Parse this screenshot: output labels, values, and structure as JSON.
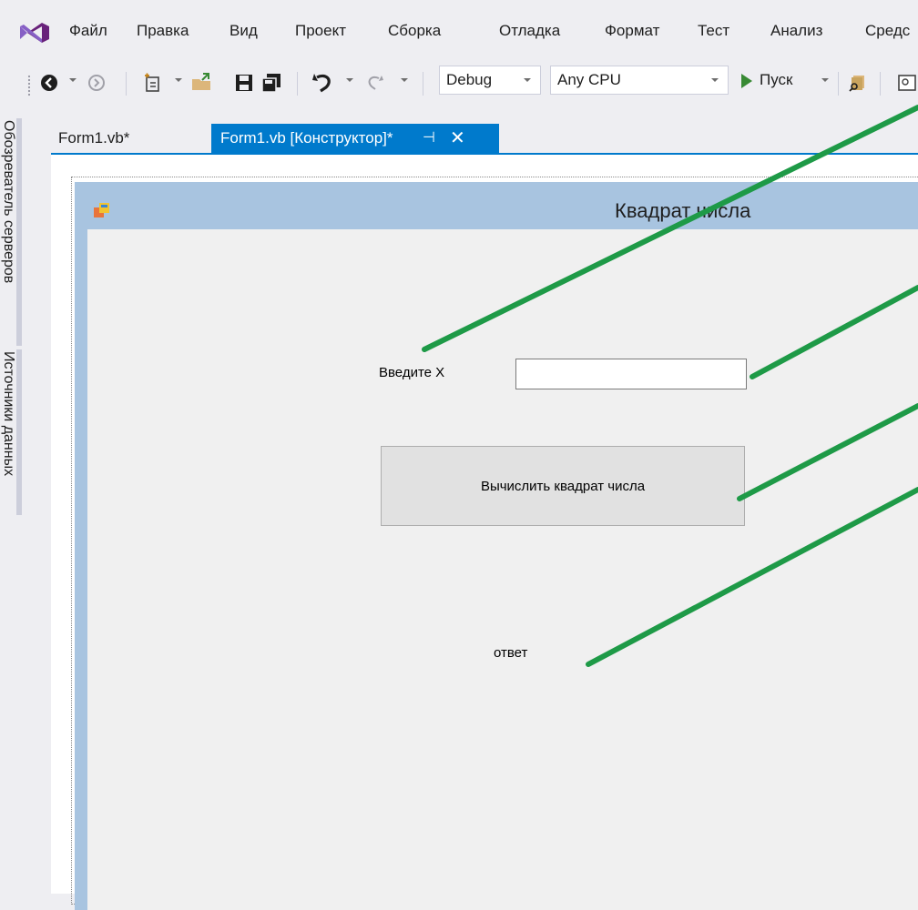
{
  "menu": {
    "items": [
      "Файл",
      "Правка",
      "Вид",
      "Проект",
      "Сборка",
      "Отладка",
      "Формат",
      "Тест",
      "Анализ",
      "Средс"
    ]
  },
  "toolbar": {
    "configuration": "Debug",
    "platform": "Any CPU",
    "start_label": "Пуск"
  },
  "side_tabs": {
    "server_explorer": "Обозреватель серверов",
    "data_sources": "Источники данных"
  },
  "document_tabs": {
    "code_tab": "Form1.vb*",
    "designer_tab": "Form1.vb [Конструктор]*",
    "pin_glyph": "⊣",
    "close_glyph": "✕"
  },
  "form": {
    "title": "Квадрат числа",
    "label_x": "Введите X",
    "input_value": "",
    "button_label": "Вычислить квадрат числа",
    "answer_label": "ответ"
  },
  "colors": {
    "accent": "#007acc",
    "annotation_line": "#1e9a47",
    "form_border": "#a8c4e0",
    "form_client": "#f0f0f0"
  }
}
